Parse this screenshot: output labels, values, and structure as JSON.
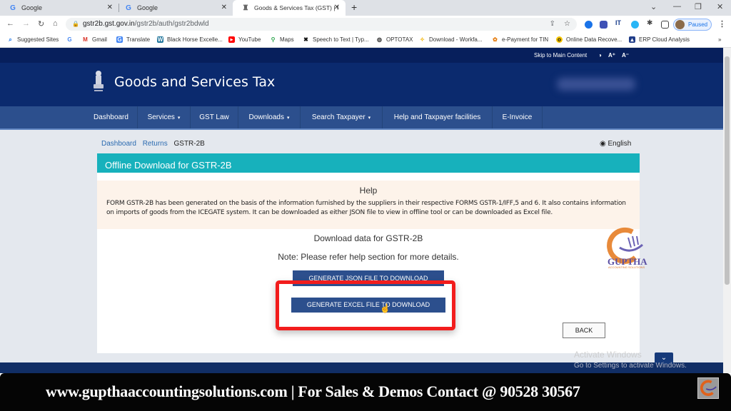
{
  "browser": {
    "tabs": [
      {
        "title": "Google",
        "icon": "google-icon",
        "active": false
      },
      {
        "title": "Google",
        "icon": "google-icon",
        "active": false
      },
      {
        "title": "Goods & Services Tax (GST) | GST",
        "icon": "gst-emblem-icon",
        "active": true
      }
    ],
    "url_host": "gstr2b.gst.gov.in",
    "url_path": "/gstr2b/auth/gstr2bdwld",
    "profile_status": "Paused",
    "bookmarks": [
      {
        "label": "Suggested Sites",
        "icon": "search-icon"
      },
      {
        "label": "",
        "icon": "google-icon"
      },
      {
        "label": "Gmail",
        "icon": "gmail-icon"
      },
      {
        "label": "Translate",
        "icon": "translate-icon"
      },
      {
        "label": "Black Horse Excelle...",
        "icon": "wordpress-icon"
      },
      {
        "label": "YouTube",
        "icon": "youtube-icon"
      },
      {
        "label": "Maps",
        "icon": "maps-icon"
      },
      {
        "label": "Speech to Text | Typ...",
        "icon": "speech-icon"
      },
      {
        "label": "OPTOTAX",
        "icon": "globe-icon"
      },
      {
        "label": "Download - Workfa...",
        "icon": "workfast-icon"
      },
      {
        "label": "e-Payment for TIN",
        "icon": "epayment-icon"
      },
      {
        "label": "Online Data Recove...",
        "icon": "recovery-icon"
      },
      {
        "label": "ERP Cloud Analysis",
        "icon": "erp-icon"
      }
    ],
    "bookmarks_overflow": "»"
  },
  "gst": {
    "skip_link": "Skip to Main Content",
    "contrast_icon": "◑",
    "font_increase": "A⁺",
    "font_decrease": "A⁻",
    "site_title": "Goods and Services Tax",
    "nav": [
      {
        "label": "Dashboard",
        "dropdown": false
      },
      {
        "label": "Services",
        "dropdown": true
      },
      {
        "label": "GST Law",
        "dropdown": false
      },
      {
        "label": "Downloads",
        "dropdown": true
      },
      {
        "label": "Search Taxpayer",
        "dropdown": true
      },
      {
        "label": "Help and Taxpayer facilities",
        "dropdown": false
      },
      {
        "label": "E-Invoice",
        "dropdown": false
      }
    ],
    "caret": "▾",
    "breadcrumb": [
      "Dashboard",
      "Returns",
      "GSTR-2B"
    ],
    "language": "English",
    "panel_title": "Offline Download for GSTR-2B",
    "help_title": "Help",
    "help_text": "FORM GSTR-2B has been generated on the basis of the information furnished by the suppliers in their respective FORMS GSTR-1/IFF,5 and 6. It also contains information on imports of goods from the ICEGATE system. It can be downloaded as either JSON file to view in offline tool or can be downloaded as Excel file.",
    "download_title": "Download data for GSTR-2B",
    "note": "Note: Please refer help section for more details.",
    "btn_json": "GENERATE JSON FILE TO DOWNLOAD",
    "btn_excel": "GENERATE EXCEL FILE TO DOWNLOAD",
    "btn_back": "BACK"
  },
  "overlay": {
    "activate_title": "Activate Windows",
    "activate_sub": "Go to Settings to activate Windows.",
    "watermark_name": "GUPTHA",
    "watermark_sub": "ACCOUNTING SOLUTIONS",
    "banner": "www.gupthaaccountingsolutions.com | For Sales & Demos Contact @ 90528 30567"
  }
}
